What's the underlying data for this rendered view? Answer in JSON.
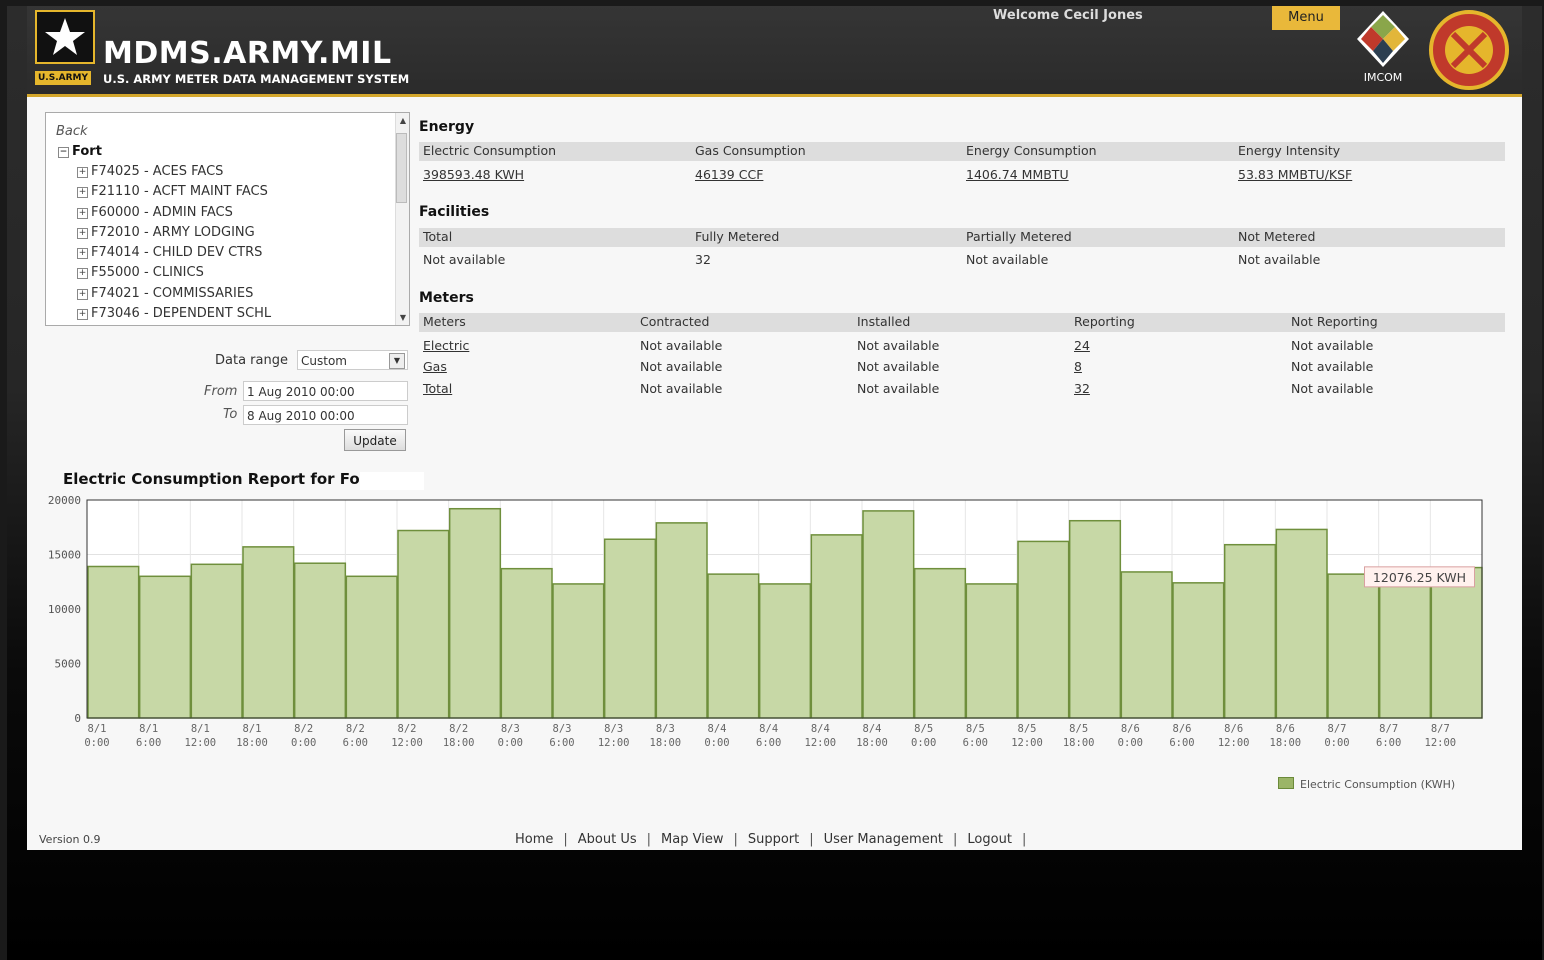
{
  "header": {
    "logo_text": "U.S.ARMY",
    "site_title": "MDMS.ARMY.MIL",
    "site_subtitle": "U.S. ARMY METER DATA MANAGEMENT SYSTEM",
    "welcome": "Welcome Cecil Jones",
    "menu_label": "Menu",
    "imcom_label": "IMCOM"
  },
  "tree": {
    "back": "Back",
    "root": "Fort",
    "items": [
      {
        "label": "F74025 - ACES FACS"
      },
      {
        "label": "F21110 - ACFT MAINT FACS"
      },
      {
        "label": "F60000 - ADMIN FACS"
      },
      {
        "label": "F72010 - ARMY LODGING"
      },
      {
        "label": "F74014 - CHILD DEV CTRS"
      },
      {
        "label": "F55000 - CLINICS"
      },
      {
        "label": "F74021 - COMMISSARIES"
      },
      {
        "label": "F73046 - DEPENDENT SCHL"
      }
    ]
  },
  "filters": {
    "data_range_label": "Data range",
    "data_range_value": "Custom",
    "from_label": "From",
    "from_value": "1 Aug 2010 00:00",
    "to_label": "To",
    "to_value": "8 Aug 2010 00:00",
    "update_label": "Update"
  },
  "energy": {
    "title": "Energy",
    "headers": [
      "Electric Consumption",
      "Gas Consumption",
      "Energy Consumption",
      "Energy Intensity"
    ],
    "values": [
      "398593.48 KWH",
      "46139 CCF",
      "1406.74 MMBTU",
      "53.83 MMBTU/KSF"
    ]
  },
  "facilities": {
    "title": "Facilities",
    "headers": [
      "Total",
      "Fully Metered",
      "Partially Metered",
      "Not Metered"
    ],
    "values": [
      "Not available",
      "32",
      "Not available",
      "Not available"
    ]
  },
  "meters": {
    "title": "Meters",
    "headers": [
      "Meters",
      "Contracted",
      "Installed",
      "Reporting",
      "Not Reporting"
    ],
    "rows": [
      [
        "Electric",
        "Not available",
        "Not available",
        "24",
        "Not available"
      ],
      [
        "Gas",
        "Not available",
        "Not available",
        "8",
        "Not available"
      ],
      [
        "Total",
        "Not available",
        "Not available",
        "32",
        "Not available"
      ]
    ]
  },
  "chart_title": "Electric Consumption Report for Fort",
  "chart_data": {
    "type": "bar",
    "title": "Electric Consumption Report for Fort",
    "series": [
      {
        "name": "Electric Consumption (KWH)",
        "color": "#c8d8a8"
      }
    ],
    "categories": [
      "8/1 0:00",
      "8/1 6:00",
      "8/1 12:00",
      "8/1 18:00",
      "8/2 0:00",
      "8/2 6:00",
      "8/2 12:00",
      "8/2 18:00",
      "8/3 0:00",
      "8/3 6:00",
      "8/3 12:00",
      "8/3 18:00",
      "8/4 0:00",
      "8/4 6:00",
      "8/4 12:00",
      "8/4 18:00",
      "8/5 0:00",
      "8/5 6:00",
      "8/5 12:00",
      "8/5 18:00",
      "8/6 0:00",
      "8/6 6:00",
      "8/6 12:00",
      "8/6 18:00",
      "8/7 0:00",
      "8/7 6:00",
      "8/7 12:00"
    ],
    "tick_labels": [
      [
        "8/1",
        "0:00"
      ],
      [
        "8/1",
        "6:00"
      ],
      [
        "8/1",
        "12:00"
      ],
      [
        "8/1",
        "18:00"
      ],
      [
        "8/2",
        "0:00"
      ],
      [
        "8/2",
        "6:00"
      ],
      [
        "8/2",
        "12:00"
      ],
      [
        "8/2",
        "18:00"
      ],
      [
        "8/3",
        "0:00"
      ],
      [
        "8/3",
        "6:00"
      ],
      [
        "8/3",
        "12:00"
      ],
      [
        "8/3",
        "18:00"
      ],
      [
        "8/4",
        "0:00"
      ],
      [
        "8/4",
        "6:00"
      ],
      [
        "8/4",
        "12:00"
      ],
      [
        "8/4",
        "18:00"
      ],
      [
        "8/5",
        "0:00"
      ],
      [
        "8/5",
        "6:00"
      ],
      [
        "8/5",
        "12:00"
      ],
      [
        "8/5",
        "18:00"
      ],
      [
        "8/6",
        "0:00"
      ],
      [
        "8/6",
        "6:00"
      ],
      [
        "8/6",
        "12:00"
      ],
      [
        "8/6",
        "18:00"
      ],
      [
        "8/7",
        "0:00"
      ],
      [
        "8/7",
        "6:00"
      ],
      [
        "8/7",
        "12:00"
      ]
    ],
    "values": [
      13900,
      13000,
      14100,
      15700,
      14200,
      13000,
      17200,
      19200,
      13700,
      12300,
      16400,
      17900,
      13200,
      12300,
      16800,
      19000,
      13700,
      12300,
      16200,
      18100,
      13400,
      12400,
      15900,
      17300,
      13200,
      12076.25,
      13800
    ],
    "ylim": [
      0,
      20000
    ],
    "yticks": [
      0,
      5000,
      10000,
      15000,
      20000
    ],
    "grid": true,
    "legend": "bottom-right",
    "tooltip": "12076.25 KWH"
  },
  "footer": {
    "version": "Version 0.9",
    "links": [
      "Home",
      "About Us",
      "Map View",
      "Support",
      "User Management",
      "Logout"
    ]
  }
}
